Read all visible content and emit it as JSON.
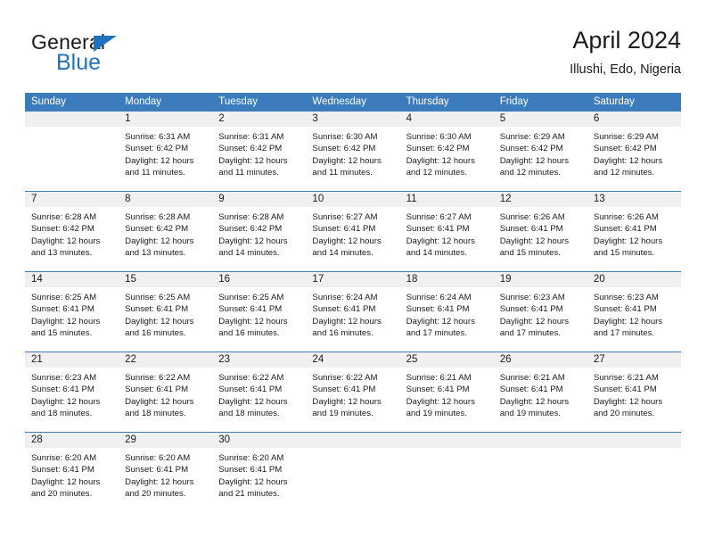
{
  "brand": {
    "name_top": "General",
    "name_bottom": "Blue",
    "accent_color": "#1f72bd"
  },
  "header": {
    "title": "April 2024",
    "subtitle": "Illushi, Edo, Nigeria"
  },
  "calendar": {
    "header_color": "#3c7cbd",
    "daynum_bg": "#f0f0f0",
    "weekdays": [
      "Sunday",
      "Monday",
      "Tuesday",
      "Wednesday",
      "Thursday",
      "Friday",
      "Saturday"
    ],
    "weeks": [
      [
        {
          "day": "",
          "sunrise": "",
          "sunset": "",
          "daylight1": "",
          "daylight2": ""
        },
        {
          "day": "1",
          "sunrise": "Sunrise: 6:31 AM",
          "sunset": "Sunset: 6:42 PM",
          "daylight1": "Daylight: 12 hours",
          "daylight2": "and 11 minutes."
        },
        {
          "day": "2",
          "sunrise": "Sunrise: 6:31 AM",
          "sunset": "Sunset: 6:42 PM",
          "daylight1": "Daylight: 12 hours",
          "daylight2": "and 11 minutes."
        },
        {
          "day": "3",
          "sunrise": "Sunrise: 6:30 AM",
          "sunset": "Sunset: 6:42 PM",
          "daylight1": "Daylight: 12 hours",
          "daylight2": "and 11 minutes."
        },
        {
          "day": "4",
          "sunrise": "Sunrise: 6:30 AM",
          "sunset": "Sunset: 6:42 PM",
          "daylight1": "Daylight: 12 hours",
          "daylight2": "and 12 minutes."
        },
        {
          "day": "5",
          "sunrise": "Sunrise: 6:29 AM",
          "sunset": "Sunset: 6:42 PM",
          "daylight1": "Daylight: 12 hours",
          "daylight2": "and 12 minutes."
        },
        {
          "day": "6",
          "sunrise": "Sunrise: 6:29 AM",
          "sunset": "Sunset: 6:42 PM",
          "daylight1": "Daylight: 12 hours",
          "daylight2": "and 12 minutes."
        }
      ],
      [
        {
          "day": "7",
          "sunrise": "Sunrise: 6:28 AM",
          "sunset": "Sunset: 6:42 PM",
          "daylight1": "Daylight: 12 hours",
          "daylight2": "and 13 minutes."
        },
        {
          "day": "8",
          "sunrise": "Sunrise: 6:28 AM",
          "sunset": "Sunset: 6:42 PM",
          "daylight1": "Daylight: 12 hours",
          "daylight2": "and 13 minutes."
        },
        {
          "day": "9",
          "sunrise": "Sunrise: 6:28 AM",
          "sunset": "Sunset: 6:42 PM",
          "daylight1": "Daylight: 12 hours",
          "daylight2": "and 14 minutes."
        },
        {
          "day": "10",
          "sunrise": "Sunrise: 6:27 AM",
          "sunset": "Sunset: 6:41 PM",
          "daylight1": "Daylight: 12 hours",
          "daylight2": "and 14 minutes."
        },
        {
          "day": "11",
          "sunrise": "Sunrise: 6:27 AM",
          "sunset": "Sunset: 6:41 PM",
          "daylight1": "Daylight: 12 hours",
          "daylight2": "and 14 minutes."
        },
        {
          "day": "12",
          "sunrise": "Sunrise: 6:26 AM",
          "sunset": "Sunset: 6:41 PM",
          "daylight1": "Daylight: 12 hours",
          "daylight2": "and 15 minutes."
        },
        {
          "day": "13",
          "sunrise": "Sunrise: 6:26 AM",
          "sunset": "Sunset: 6:41 PM",
          "daylight1": "Daylight: 12 hours",
          "daylight2": "and 15 minutes."
        }
      ],
      [
        {
          "day": "14",
          "sunrise": "Sunrise: 6:25 AM",
          "sunset": "Sunset: 6:41 PM",
          "daylight1": "Daylight: 12 hours",
          "daylight2": "and 15 minutes."
        },
        {
          "day": "15",
          "sunrise": "Sunrise: 6:25 AM",
          "sunset": "Sunset: 6:41 PM",
          "daylight1": "Daylight: 12 hours",
          "daylight2": "and 16 minutes."
        },
        {
          "day": "16",
          "sunrise": "Sunrise: 6:25 AM",
          "sunset": "Sunset: 6:41 PM",
          "daylight1": "Daylight: 12 hours",
          "daylight2": "and 16 minutes."
        },
        {
          "day": "17",
          "sunrise": "Sunrise: 6:24 AM",
          "sunset": "Sunset: 6:41 PM",
          "daylight1": "Daylight: 12 hours",
          "daylight2": "and 16 minutes."
        },
        {
          "day": "18",
          "sunrise": "Sunrise: 6:24 AM",
          "sunset": "Sunset: 6:41 PM",
          "daylight1": "Daylight: 12 hours",
          "daylight2": "and 17 minutes."
        },
        {
          "day": "19",
          "sunrise": "Sunrise: 6:23 AM",
          "sunset": "Sunset: 6:41 PM",
          "daylight1": "Daylight: 12 hours",
          "daylight2": "and 17 minutes."
        },
        {
          "day": "20",
          "sunrise": "Sunrise: 6:23 AM",
          "sunset": "Sunset: 6:41 PM",
          "daylight1": "Daylight: 12 hours",
          "daylight2": "and 17 minutes."
        }
      ],
      [
        {
          "day": "21",
          "sunrise": "Sunrise: 6:23 AM",
          "sunset": "Sunset: 6:41 PM",
          "daylight1": "Daylight: 12 hours",
          "daylight2": "and 18 minutes."
        },
        {
          "day": "22",
          "sunrise": "Sunrise: 6:22 AM",
          "sunset": "Sunset: 6:41 PM",
          "daylight1": "Daylight: 12 hours",
          "daylight2": "and 18 minutes."
        },
        {
          "day": "23",
          "sunrise": "Sunrise: 6:22 AM",
          "sunset": "Sunset: 6:41 PM",
          "daylight1": "Daylight: 12 hours",
          "daylight2": "and 18 minutes."
        },
        {
          "day": "24",
          "sunrise": "Sunrise: 6:22 AM",
          "sunset": "Sunset: 6:41 PM",
          "daylight1": "Daylight: 12 hours",
          "daylight2": "and 19 minutes."
        },
        {
          "day": "25",
          "sunrise": "Sunrise: 6:21 AM",
          "sunset": "Sunset: 6:41 PM",
          "daylight1": "Daylight: 12 hours",
          "daylight2": "and 19 minutes."
        },
        {
          "day": "26",
          "sunrise": "Sunrise: 6:21 AM",
          "sunset": "Sunset: 6:41 PM",
          "daylight1": "Daylight: 12 hours",
          "daylight2": "and 19 minutes."
        },
        {
          "day": "27",
          "sunrise": "Sunrise: 6:21 AM",
          "sunset": "Sunset: 6:41 PM",
          "daylight1": "Daylight: 12 hours",
          "daylight2": "and 20 minutes."
        }
      ],
      [
        {
          "day": "28",
          "sunrise": "Sunrise: 6:20 AM",
          "sunset": "Sunset: 6:41 PM",
          "daylight1": "Daylight: 12 hours",
          "daylight2": "and 20 minutes."
        },
        {
          "day": "29",
          "sunrise": "Sunrise: 6:20 AM",
          "sunset": "Sunset: 6:41 PM",
          "daylight1": "Daylight: 12 hours",
          "daylight2": "and 20 minutes."
        },
        {
          "day": "30",
          "sunrise": "Sunrise: 6:20 AM",
          "sunset": "Sunset: 6:41 PM",
          "daylight1": "Daylight: 12 hours",
          "daylight2": "and 21 minutes."
        },
        {
          "day": "",
          "sunrise": "",
          "sunset": "",
          "daylight1": "",
          "daylight2": ""
        },
        {
          "day": "",
          "sunrise": "",
          "sunset": "",
          "daylight1": "",
          "daylight2": ""
        },
        {
          "day": "",
          "sunrise": "",
          "sunset": "",
          "daylight1": "",
          "daylight2": ""
        },
        {
          "day": "",
          "sunrise": "",
          "sunset": "",
          "daylight1": "",
          "daylight2": ""
        }
      ]
    ]
  }
}
